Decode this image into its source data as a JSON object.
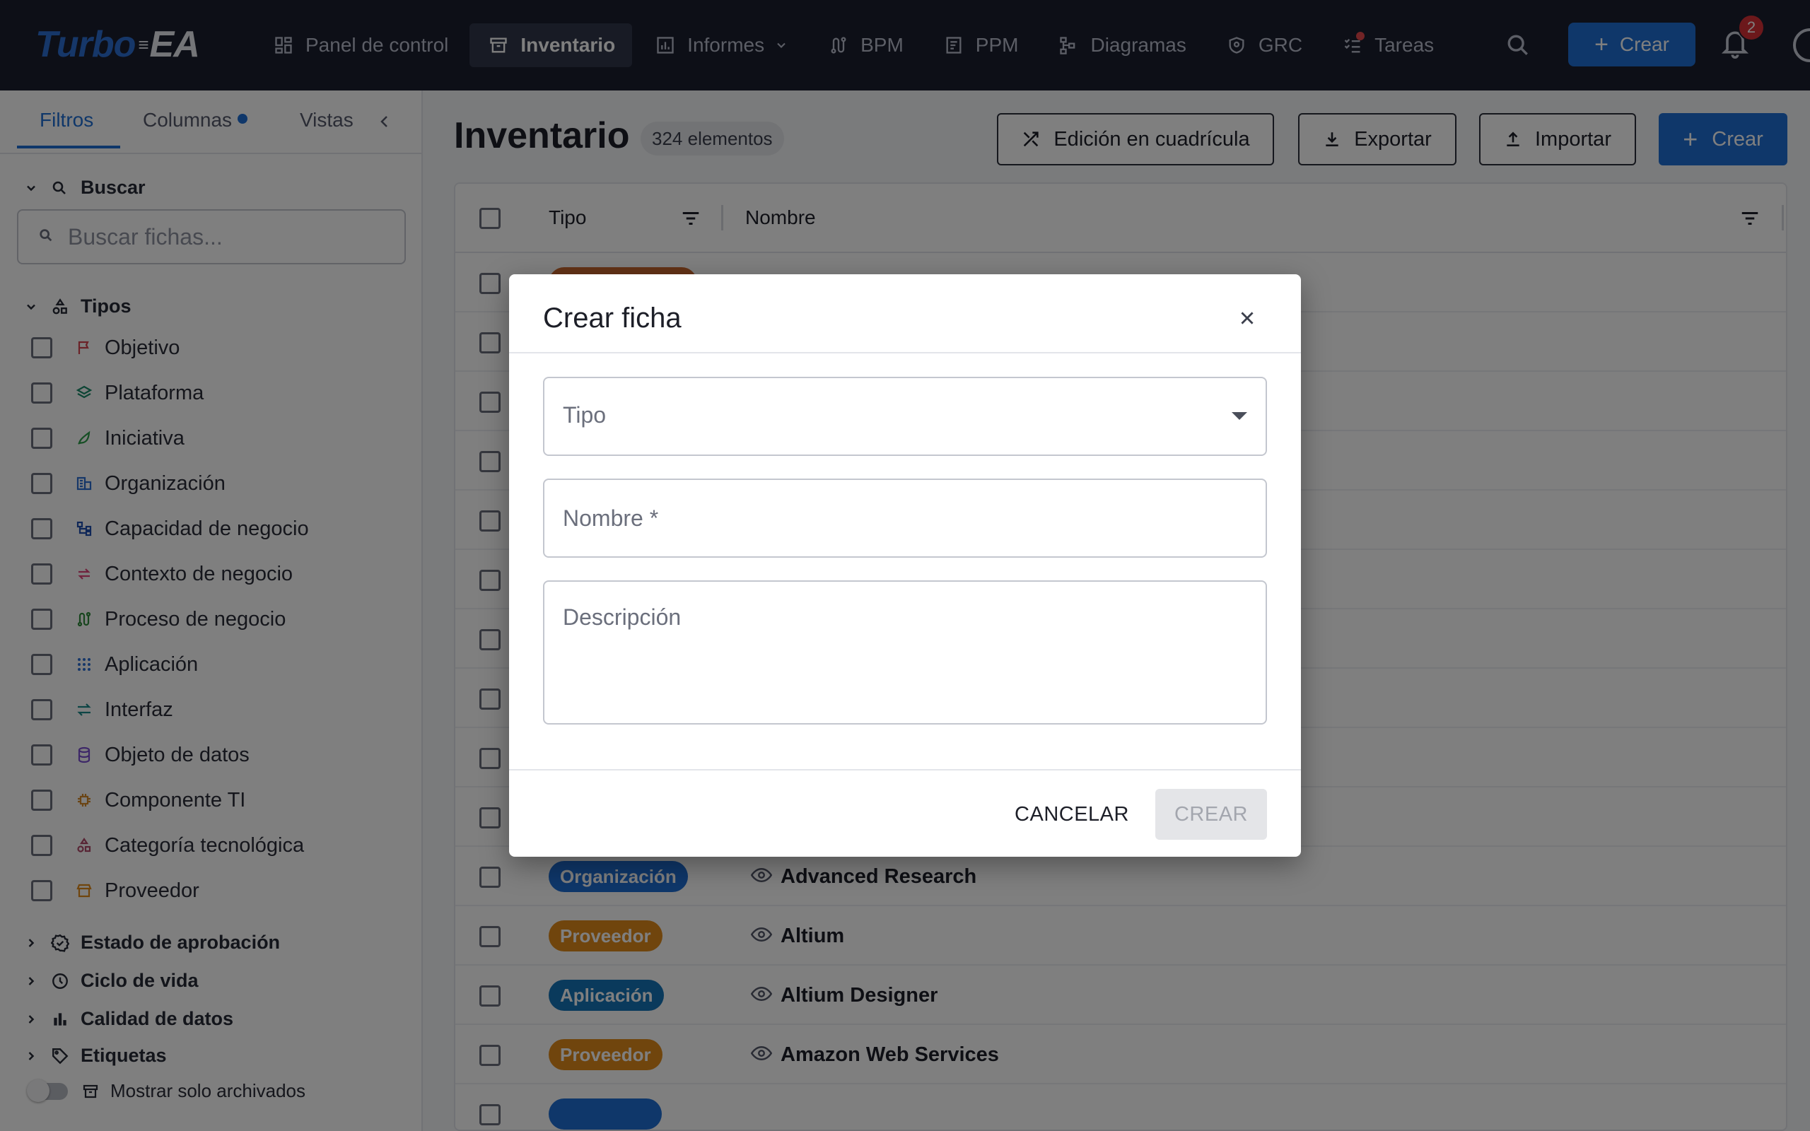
{
  "app": {
    "logo_part1": "Turbo",
    "logo_part2": "EA"
  },
  "nav": {
    "items": [
      {
        "label": "Panel de control",
        "icon": "dashboard-icon",
        "active": false
      },
      {
        "label": "Inventario",
        "icon": "inventory-icon",
        "active": true
      },
      {
        "label": "Informes",
        "icon": "reports-icon",
        "active": false,
        "has_dropdown": true
      },
      {
        "label": "BPM",
        "icon": "bpm-icon",
        "active": false
      },
      {
        "label": "PPM",
        "icon": "ppm-icon",
        "active": false
      },
      {
        "label": "Diagramas",
        "icon": "diagrams-icon",
        "active": false
      },
      {
        "label": "GRC",
        "icon": "shield-icon",
        "active": false
      },
      {
        "label": "Tareas",
        "icon": "tasks-icon",
        "active": false,
        "has_dot": true
      }
    ],
    "create_label": "Crear",
    "notification_count": "2"
  },
  "sidebar": {
    "tabs": [
      {
        "label": "Filtros",
        "active": true
      },
      {
        "label": "Columnas",
        "active": false,
        "has_dot": true
      },
      {
        "label": "Vistas",
        "active": false
      }
    ],
    "search_section": "Buscar",
    "search_placeholder": "Buscar fichas...",
    "types_section": "Tipos",
    "types": [
      {
        "label": "Objetivo",
        "icon": "flag-icon",
        "color": "#d64550"
      },
      {
        "label": "Plataforma",
        "icon": "layers-icon",
        "color": "#1a8a6a"
      },
      {
        "label": "Iniciativa",
        "icon": "rocket-icon",
        "color": "#2e9e4a"
      },
      {
        "label": "Organización",
        "icon": "building-icon",
        "color": "#2d6fd3"
      },
      {
        "label": "Capacidad de negocio",
        "icon": "hierarchy-icon",
        "color": "#1f4fb0"
      },
      {
        "label": "Contexto de negocio",
        "icon": "swap-icon",
        "color": "#e0457b"
      },
      {
        "label": "Proceso de negocio",
        "icon": "route-icon",
        "color": "#2e8a3a"
      },
      {
        "label": "Aplicación",
        "icon": "apps-grid-icon",
        "color": "#2d6fd3"
      },
      {
        "label": "Interfaz",
        "icon": "arrows-icon",
        "color": "#1a8a8a"
      },
      {
        "label": "Objeto de datos",
        "icon": "database-icon",
        "color": "#7a4fd0"
      },
      {
        "label": "Componente TI",
        "icon": "chip-icon",
        "color": "#d68a2a"
      },
      {
        "label": "Categoría tecnológica",
        "icon": "category-icon",
        "color": "#b04a6a"
      },
      {
        "label": "Proveedor",
        "icon": "store-icon",
        "color": "#e08a1a"
      }
    ],
    "collapsed_sections": [
      {
        "label": "Estado de aprobación",
        "icon": "badge-check-icon"
      },
      {
        "label": "Ciclo de vida",
        "icon": "clock-icon"
      },
      {
        "label": "Calidad de datos",
        "icon": "bar-chart-icon"
      },
      {
        "label": "Etiquetas",
        "icon": "tag-icon"
      }
    ],
    "archived_toggle": "Mostrar solo archivados"
  },
  "main": {
    "title": "Inventario",
    "count": "324 elementos",
    "actions": {
      "grid_edit": "Edición en cuadrícula",
      "export": "Exportar",
      "import": "Importar",
      "create": "Crear"
    },
    "columns": [
      "Tipo",
      "Nombre"
    ],
    "rows": [
      {
        "type": "Organización",
        "type_color": "#1f6ed4",
        "name": "Advanced Research"
      },
      {
        "type": "Proveedor",
        "type_color": "#e08a1a",
        "name": "Altium"
      },
      {
        "type": "Aplicación",
        "type_color": "#1574b8",
        "name": "Altium Designer"
      },
      {
        "type": "Proveedor",
        "type_color": "#e08a1a",
        "name": "Amazon Web Services"
      }
    ]
  },
  "dialog": {
    "title": "Crear ficha",
    "type_label": "Tipo",
    "name_placeholder": "Nombre *",
    "description_placeholder": "Descripción",
    "cancel_label": "CANCELAR",
    "create_label": "CREAR"
  }
}
